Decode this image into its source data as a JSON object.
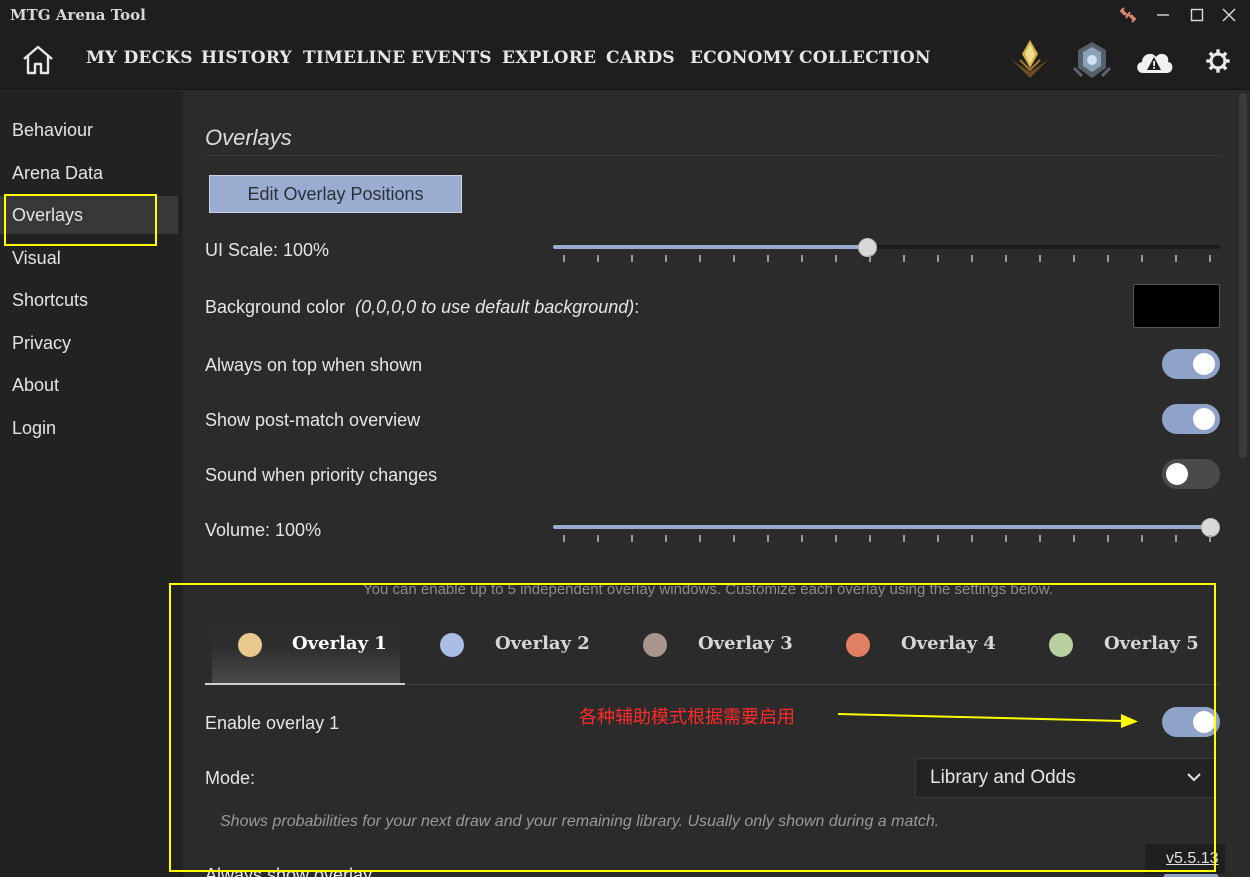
{
  "window": {
    "title": "MTG Arena Tool",
    "controls": [
      "minimize",
      "maximize",
      "close"
    ]
  },
  "nav": {
    "items": [
      "MY DECKS",
      "HISTORY",
      "TIMELINE",
      "EVENTS",
      "EXPLORE",
      "CARDS",
      "ECONOMY",
      "COLLECTION"
    ],
    "icons": [
      "home-icon",
      "constructed-rank-icon",
      "limited-rank-icon",
      "cloud-warning-icon",
      "gear-icon"
    ]
  },
  "sidebar": {
    "items": [
      "Behaviour",
      "Arena Data",
      "Overlays",
      "Visual",
      "Shortcuts",
      "Privacy",
      "About",
      "Login"
    ],
    "active": "Overlays"
  },
  "overlays": {
    "title": "Overlays",
    "edit_button": "Edit Overlay Positions",
    "ui_scale_label": "UI Scale: 100%",
    "ui_scale_value": 0.47,
    "bg_color_label": "Background color",
    "bg_color_hint": "(0,0,0,0 to use default background)",
    "bg_color_suffix": ":",
    "bg_color_value": "#000000",
    "always_on_top_label": "Always on top when shown",
    "always_on_top": true,
    "post_match_label": "Show post-match overview",
    "post_match": true,
    "sound_priority_label": "Sound when priority changes",
    "sound_priority": false,
    "volume_label": "Volume: 100%",
    "volume_value": 1.0,
    "info": "You can enable up to 5 independent overlay windows. Customize each overlay using the settings below.",
    "tabs": [
      {
        "label": "Overlay 1",
        "color": "#e8c88c"
      },
      {
        "label": "Overlay 2",
        "color": "#a9bde6"
      },
      {
        "label": "Overlay 3",
        "color": "#a8958c"
      },
      {
        "label": "Overlay 4",
        "color": "#e07f62"
      },
      {
        "label": "Overlay 5",
        "color": "#b8cf9f"
      }
    ],
    "active_tab": "Overlay 1",
    "enable_label": "Enable overlay 1",
    "enable": true,
    "mode_label": "Mode:",
    "mode_value": "Library and Odds",
    "mode_description": "Shows probabilities for your next draw and your remaining library. Usually only shown during a match.",
    "next_label_partial": "Always show overlay",
    "annotation": "各种辅助模式根据需要启用",
    "version": "v5.5.13"
  },
  "colors": {
    "accent": "#9aadd1",
    "highlight": "#ffff00",
    "annotation": "#ff2a2a"
  }
}
